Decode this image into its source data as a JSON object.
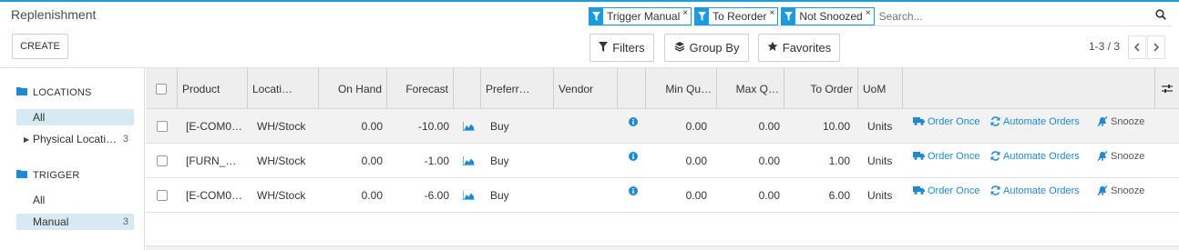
{
  "title": "Replenishment",
  "create_label": "CREATE",
  "facets": [
    {
      "label": "Trigger Manual"
    },
    {
      "label": "To Reorder"
    },
    {
      "label": "Not Snoozed"
    }
  ],
  "search_placeholder": "Search...",
  "toolbar": {
    "filters": "Filters",
    "group_by": "Group By",
    "favorites": "Favorites"
  },
  "pager": {
    "text": "1-3 / 3"
  },
  "sidebar": {
    "locations": {
      "header": "LOCATIONS",
      "items": [
        {
          "label": "All",
          "count": "",
          "selected": true
        },
        {
          "label": "Physical Locati…",
          "count": "3",
          "selected": false
        }
      ]
    },
    "trigger": {
      "header": "TRIGGER",
      "items": [
        {
          "label": "All",
          "count": "",
          "selected": false
        },
        {
          "label": "Manual",
          "count": "3",
          "selected": true
        }
      ]
    }
  },
  "table": {
    "columns": {
      "product": "Product",
      "location": "Locati…",
      "on_hand": "On Hand",
      "forecast": "Forecast",
      "preferred": "Preferr…",
      "vendor": "Vendor",
      "min_qty": "Min Qu…",
      "max_qty": "Max Q…",
      "to_order": "To Order",
      "uom": "UoM"
    },
    "rows": [
      {
        "product": "[E-COM0…",
        "location": "WH/Stock",
        "on_hand": "0.00",
        "forecast": "-10.00",
        "route": "Buy",
        "vendor": "",
        "min": "0.00",
        "max": "0.00",
        "to_order": "10.00",
        "uom": "Units"
      },
      {
        "product": "[FURN_…",
        "location": "WH/Stock",
        "on_hand": "0.00",
        "forecast": "-1.00",
        "route": "Buy",
        "vendor": "",
        "min": "0.00",
        "max": "0.00",
        "to_order": "1.00",
        "uom": "Units"
      },
      {
        "product": "[E-COM0…",
        "location": "WH/Stock",
        "on_hand": "0.00",
        "forecast": "-6.00",
        "route": "Buy",
        "vendor": "",
        "min": "0.00",
        "max": "0.00",
        "to_order": "6.00",
        "uom": "Units"
      }
    ],
    "actions": {
      "order_once": "Order Once",
      "automate": "Automate Orders",
      "snooze": "Snooze"
    }
  },
  "colors": {
    "accent": "#1b9bdb",
    "link": "#1f8ad1",
    "selected_bg": "#d7e9f3",
    "header_bg": "#eeeeee"
  }
}
